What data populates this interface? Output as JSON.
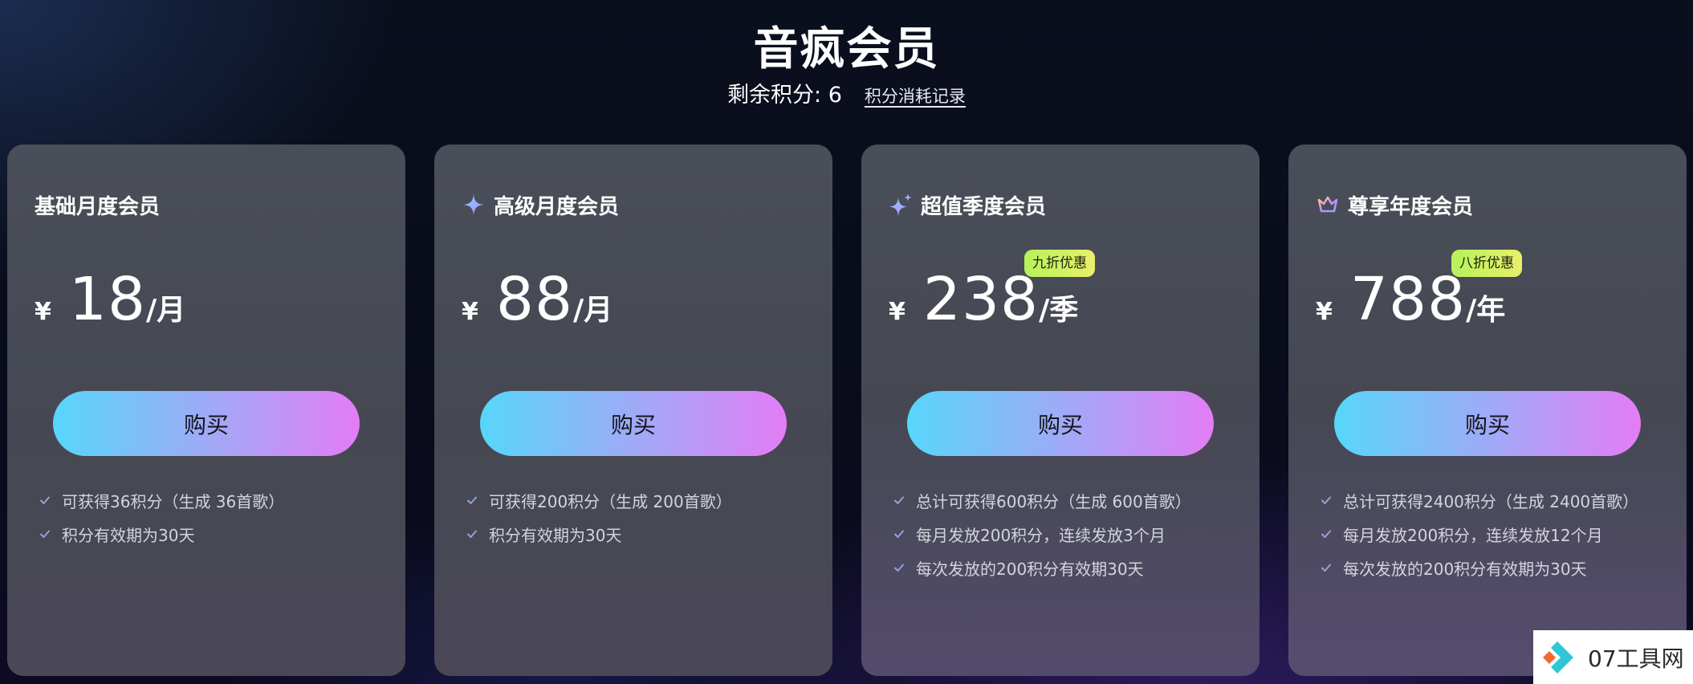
{
  "header": {
    "title": "音疯会员",
    "points_text": "剩余积分: 6",
    "points_link": "积分消耗记录"
  },
  "colors": {
    "button_gradient_start": "#57d6fb",
    "button_gradient_end": "#e47cf6",
    "badge": "#c8f25e",
    "card_bg": "#4a4e58"
  },
  "plans": [
    {
      "name": "基础月度会员",
      "icon": "none",
      "currency": "¥",
      "amount": "18",
      "period": "/月",
      "badge": "",
      "button_label": "购买",
      "features": [
        "可获得36积分（生成 36首歌）",
        "积分有效期为30天"
      ]
    },
    {
      "name": "高级月度会员",
      "icon": "sparkle-icon",
      "currency": "¥",
      "amount": "88",
      "period": "/月",
      "badge": "",
      "button_label": "购买",
      "features": [
        "可获得200积分（生成 200首歌）",
        "积分有效期为30天"
      ]
    },
    {
      "name": "超值季度会员",
      "icon": "double-sparkle-icon",
      "currency": "¥",
      "amount": "238",
      "period": "/季",
      "badge": "九折优惠",
      "button_label": "购买",
      "features": [
        "总计可获得600积分（生成 600首歌）",
        "每月发放200积分，连续发放3个月",
        "每次发放的200积分有效期30天"
      ]
    },
    {
      "name": "尊享年度会员",
      "icon": "crown-icon",
      "currency": "¥",
      "amount": "788",
      "period": "/年",
      "badge": "八折优惠",
      "button_label": "购买",
      "features": [
        "总计可获得2400积分（生成 2400首歌）",
        "每月发放200积分，连续发放12个月",
        "每次发放的200积分有效期为30天"
      ]
    }
  ],
  "watermark": {
    "text": "07工具网"
  }
}
